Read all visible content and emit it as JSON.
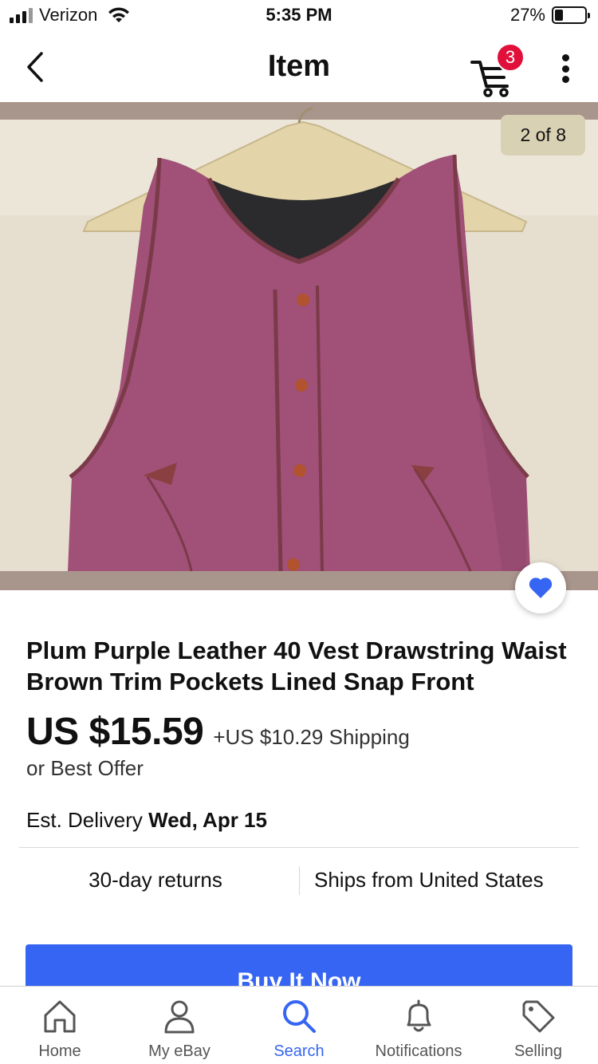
{
  "status_bar": {
    "carrier": "Verizon",
    "time": "5:35 PM",
    "battery_percent_label": "27%",
    "battery_level": 0.27
  },
  "header": {
    "title": "Item",
    "cart_count": "3"
  },
  "gallery": {
    "counter": "2 of 8",
    "current_image": 2,
    "total_images": 8
  },
  "item": {
    "title": "Plum Purple Leather 40 Vest Drawstring Waist Brown Trim Pockets Lined Snap Front",
    "price": "US $15.59",
    "shipping": "+US $10.29 Shipping",
    "best_offer": "or Best Offer",
    "delivery_label": "Est. Delivery",
    "delivery_date": "Wed, Apr 15",
    "returns": "30-day returns",
    "ships_from": "Ships from United States"
  },
  "actions": {
    "buy_now_label": "Buy It Now"
  },
  "tab_bar": {
    "tabs": [
      {
        "label": "Home",
        "icon": "home-icon"
      },
      {
        "label": "My eBay",
        "icon": "person-icon"
      },
      {
        "label": "Search",
        "icon": "search-icon"
      },
      {
        "label": "Notifications",
        "icon": "bell-icon"
      },
      {
        "label": "Selling",
        "icon": "tag-icon"
      }
    ],
    "active": "Search"
  },
  "colors": {
    "accent": "#3665f3",
    "badge": "#e0103a",
    "text": "#111111"
  }
}
